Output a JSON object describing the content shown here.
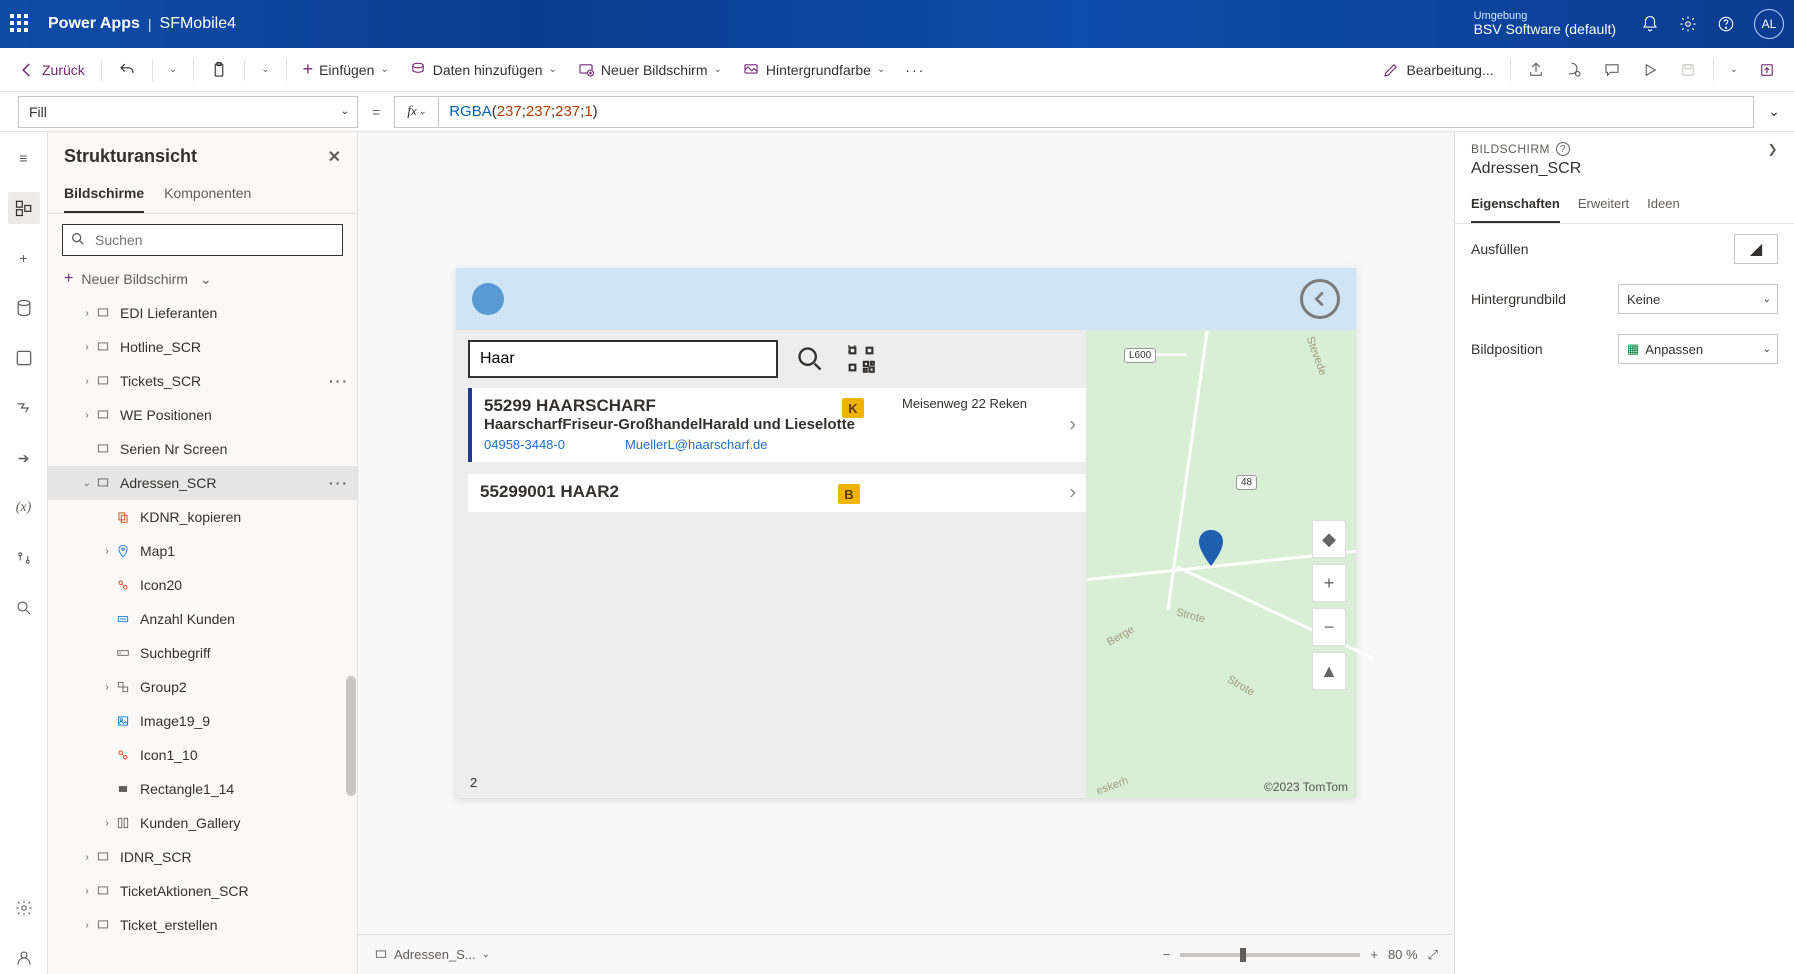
{
  "header": {
    "brand": "Power Apps",
    "appname": "SFMobile4",
    "env_label": "Umgebung",
    "env_value": "BSV Software (default)",
    "avatar": "AL"
  },
  "cmdbar": {
    "back": "Zurück",
    "insert": "Einfügen",
    "adddata": "Daten hinzufügen",
    "newscreen": "Neuer Bildschirm",
    "bgcolor": "Hintergrundfarbe",
    "editing": "Bearbeitung..."
  },
  "formula": {
    "property": "Fill",
    "fn": "RGBA",
    "args": [
      "237",
      "237",
      "237",
      "1"
    ]
  },
  "tree": {
    "title": "Strukturansicht",
    "tab_screens": "Bildschirme",
    "tab_components": "Komponenten",
    "search_placeholder": "Suchen",
    "newscreen": "Neuer Bildschirm",
    "nodes": [
      {
        "label": "EDI Lieferanten",
        "depth": 1,
        "caret": ">",
        "icon": "screen"
      },
      {
        "label": "Hotline_SCR",
        "depth": 1,
        "caret": ">",
        "icon": "screen"
      },
      {
        "label": "Tickets_SCR",
        "depth": 1,
        "caret": ">",
        "icon": "screen",
        "more": true
      },
      {
        "label": "WE Positionen",
        "depth": 1,
        "caret": ">",
        "icon": "screen"
      },
      {
        "label": "Serien Nr Screen",
        "depth": 1,
        "caret": "",
        "icon": "screen"
      },
      {
        "label": "Adressen_SCR",
        "depth": 1,
        "caret": "v",
        "icon": "screen",
        "selected": true,
        "more": true
      },
      {
        "label": "KDNR_kopieren",
        "depth": 2,
        "caret": "",
        "icon": "copy"
      },
      {
        "label": "Map1",
        "depth": 2,
        "caret": ">",
        "icon": "map"
      },
      {
        "label": "Icon20",
        "depth": 2,
        "caret": "",
        "icon": "icon"
      },
      {
        "label": "Anzahl Kunden",
        "depth": 2,
        "caret": "",
        "icon": "label"
      },
      {
        "label": "Suchbegriff",
        "depth": 2,
        "caret": "",
        "icon": "textinput"
      },
      {
        "label": "Group2",
        "depth": 2,
        "caret": ">",
        "icon": "group"
      },
      {
        "label": "Image19_9",
        "depth": 2,
        "caret": "",
        "icon": "image"
      },
      {
        "label": "Icon1_10",
        "depth": 2,
        "caret": "",
        "icon": "icon"
      },
      {
        "label": "Rectangle1_14",
        "depth": 2,
        "caret": "",
        "icon": "rect"
      },
      {
        "label": "Kunden_Gallery",
        "depth": 2,
        "caret": ">",
        "icon": "gallery"
      },
      {
        "label": "IDNR_SCR",
        "depth": 1,
        "caret": ">",
        "icon": "screen"
      },
      {
        "label": "TicketAktionen_SCR",
        "depth": 1,
        "caret": ">",
        "icon": "screen"
      },
      {
        "label": "Ticket_erstellen",
        "depth": 1,
        "caret": ">",
        "icon": "screen"
      }
    ]
  },
  "canvas": {
    "breadcrumb": "Adressen_S...",
    "zoom": "80  %",
    "app": {
      "search_value": "Haar",
      "count": "2",
      "items": [
        {
          "title": "55299 HAARSCHARF",
          "sub": "HaarscharfFriseur-GroßhandelHarald und Lieselotte",
          "phone": "04958-3448-0",
          "email": "MuellerL@haarscharf.de",
          "badge": "K",
          "addr": "Meisenweg 22 Reken",
          "selected": true
        },
        {
          "title": "55299001 HAAR2",
          "sub": "",
          "phone": "",
          "email": "",
          "badge": "B",
          "addr": "",
          "selected": false
        }
      ],
      "map": {
        "labels": [
          "Stevede",
          "Berge",
          "Strote",
          "Strote",
          "eskerh"
        ],
        "shields": [
          "L600",
          "48"
        ],
        "attribution": "©2023 TomTom"
      }
    }
  },
  "props": {
    "header": "BILDSCHIRM",
    "title": "Adressen_SCR",
    "tabs": [
      "Eigenschaften",
      "Erweitert",
      "Ideen"
    ],
    "rows": {
      "fill_label": "Ausfüllen",
      "bgimg_label": "Hintergrundbild",
      "bgimg_value": "Keine",
      "imgpos_label": "Bildposition",
      "imgpos_value": "Anpassen"
    }
  }
}
